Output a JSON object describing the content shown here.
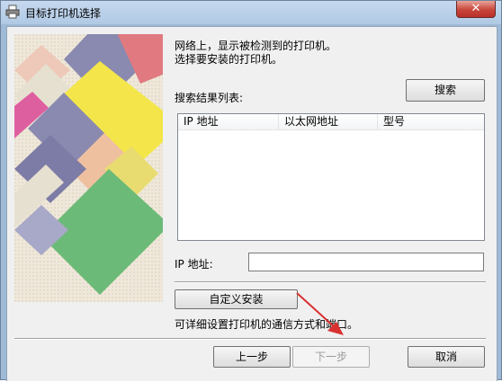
{
  "window": {
    "title": "目标打印机选择",
    "close_label": "✕"
  },
  "intro": {
    "line1": "网络上，显示被检测到的打印机。",
    "line2": "选择要安装的打印机。"
  },
  "search": {
    "label": "搜索结果列表:",
    "button": "搜索"
  },
  "results_table": {
    "columns": [
      "IP 地址",
      "以太网地址",
      "型号"
    ],
    "rows": []
  },
  "ip_field": {
    "label": "IP 地址:",
    "value": ""
  },
  "custom_install": {
    "button": "自定义安装",
    "description": "可详细设置打印机的通信方式和端口。"
  },
  "footer": {
    "back": "上一步",
    "next": "下一步",
    "cancel": "取消"
  },
  "colors": {
    "annotation_arrow": "#d93030",
    "title_bar": "#b9d1ea"
  },
  "icons": {
    "app": "printer-icon",
    "close": "close-icon"
  }
}
